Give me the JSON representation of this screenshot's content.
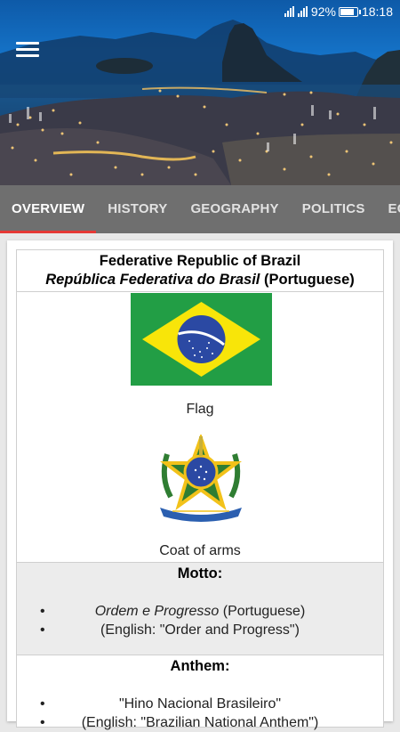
{
  "status_bar": {
    "battery": "92%",
    "time": "18:18"
  },
  "header": {
    "image": "Rio de Janeiro night skyline with Sugarloaf Mountain",
    "menu_icon": "hamburger-menu-icon"
  },
  "tabs": [
    {
      "label": "OVERVIEW",
      "active": true
    },
    {
      "label": "HISTORY",
      "active": false
    },
    {
      "label": "GEOGRAPHY",
      "active": false
    },
    {
      "label": "POLITICS",
      "active": false
    },
    {
      "label": "ECON",
      "active": false
    }
  ],
  "infobox": {
    "title": "Federative Republic of Brazil",
    "native_name": "República Federativa do Brasil",
    "native_language": "(Portuguese)",
    "flag_caption": "Flag",
    "coat_caption": "Coat of arms",
    "motto": {
      "heading": "Motto:",
      "items": [
        {
          "italic": "Ordem e Progresso",
          "rest": " (Portuguese)"
        },
        {
          "italic": "",
          "rest": "(English: \"Order and Progress\")"
        }
      ]
    },
    "anthem": {
      "heading": "Anthem:",
      "items": [
        {
          "text": "\"Hino Nacional Brasileiro\""
        },
        {
          "text": "(English: \"Brazilian National Anthem\")"
        }
      ]
    }
  },
  "colors": {
    "tab_bar": "#6f6f6f",
    "tab_indicator": "#e53935",
    "flag_green": "#229e45",
    "flag_yellow": "#f8e509",
    "flag_blue": "#2b49a3"
  }
}
